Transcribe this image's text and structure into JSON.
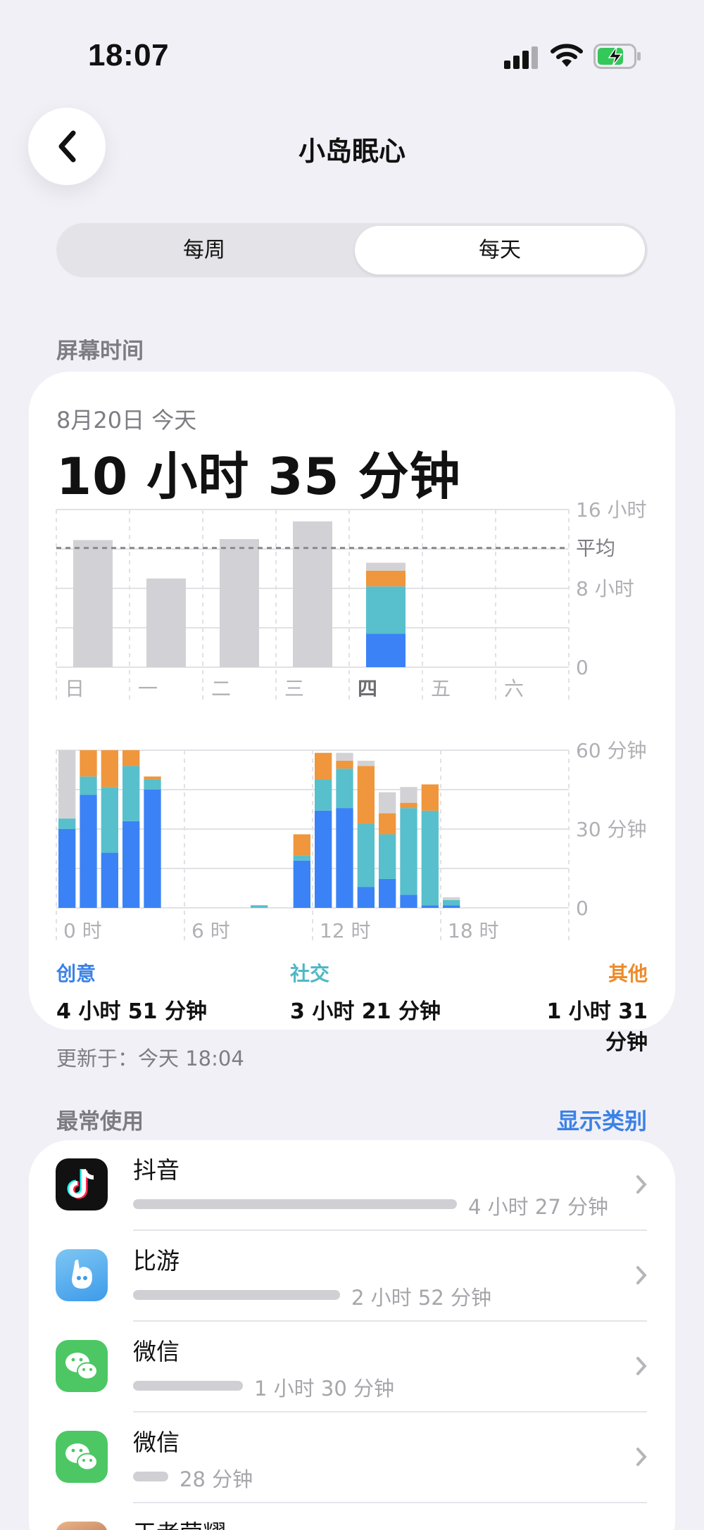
{
  "status_bar": {
    "time": "18:07"
  },
  "nav": {
    "title": "小岛眠心",
    "back_icon": "chevron-left-icon"
  },
  "segment": {
    "weekly_label": "每周",
    "daily_label": "每天",
    "selected": "每天"
  },
  "screen_time": {
    "section_label": "屏幕时间",
    "date": "8月20日 今天",
    "total": "10 小时 35 分钟",
    "updated": "更新于：今天 18:04"
  },
  "colors": {
    "creative": "#3b82f6",
    "social": "#57c0cc",
    "other": "#f0963c",
    "uncategorized": "#d2d2d6",
    "accent": "#3b82e6"
  },
  "chart_data": [
    {
      "type": "bar",
      "categories": [
        "日",
        "一",
        "二",
        "三",
        "四",
        "五",
        "六"
      ],
      "y_tick_labels": [
        "16 小时",
        "8 小时",
        "0"
      ],
      "average_label": "平均",
      "ylim_hours": [
        0,
        16
      ],
      "average_hours": 12.1,
      "series": [
        {
          "name": "creative",
          "values_hours": [
            0,
            0,
            0,
            0,
            3.4
          ]
        },
        {
          "name": "social",
          "values_hours": [
            0,
            0,
            0,
            0,
            4.8
          ]
        },
        {
          "name": "other",
          "values_hours": [
            0,
            0,
            0,
            0,
            1.6
          ]
        },
        {
          "name": "uncategorized",
          "values_hours": [
            12.9,
            9.0,
            13.0,
            14.8,
            0.8
          ]
        }
      ]
    },
    {
      "type": "bar",
      "categories": [
        "0",
        "1",
        "2",
        "3",
        "4",
        "5",
        "6",
        "7",
        "8",
        "9",
        "10",
        "11",
        "12",
        "13",
        "14",
        "15",
        "16",
        "17",
        "18",
        "19",
        "20",
        "21",
        "22",
        "23"
      ],
      "x_tick_labels": [
        "0 时",
        "6 时",
        "12 时",
        "18 时"
      ],
      "y_tick_labels": [
        "60 分钟",
        "30 分钟",
        "0"
      ],
      "ylim_minutes": [
        0,
        60
      ],
      "series": [
        {
          "name": "creative",
          "values": [
            30,
            43,
            21,
            33,
            45,
            0,
            0,
            0,
            0,
            0,
            0,
            18,
            37,
            38,
            8,
            11,
            5,
            1,
            1,
            0,
            0,
            0,
            0,
            0
          ]
        },
        {
          "name": "social",
          "values": [
            4,
            7,
            25,
            21,
            4,
            0,
            0,
            0,
            0,
            1,
            0,
            2,
            12,
            15,
            24,
            17,
            33,
            36,
            2,
            0,
            0,
            0,
            0,
            0
          ]
        },
        {
          "name": "other",
          "values": [
            0,
            10,
            14,
            6,
            1,
            0,
            0,
            0,
            0,
            0,
            0,
            8,
            10,
            3,
            22,
            8,
            2,
            10,
            0,
            0,
            0,
            0,
            0,
            0
          ]
        },
        {
          "name": "uncategorized",
          "values": [
            26,
            0,
            0,
            0,
            0,
            0,
            0,
            0,
            0,
            0,
            0,
            0,
            0,
            3,
            2,
            8,
            6,
            0,
            1,
            0,
            0,
            0,
            0,
            0
          ]
        }
      ]
    }
  ],
  "legend": [
    {
      "category": "创意",
      "value": "4 小时 51 分钟"
    },
    {
      "category": "社交",
      "value": "3 小时 21 分钟"
    },
    {
      "category": "其他",
      "value": "1 小时 31 分钟"
    }
  ],
  "most_used": {
    "section_label": "最常使用",
    "show_categories": "显示类别",
    "apps": [
      {
        "name": "抖音",
        "duration": "4 小时 27 分钟",
        "usage_fraction": 1.0,
        "icon": "douyin-icon"
      },
      {
        "name": "比游",
        "duration": "2 小时 52 分钟",
        "usage_fraction": 0.64,
        "icon": "biyou-icon"
      },
      {
        "name": "微信",
        "duration": "1 小时 30 分钟",
        "usage_fraction": 0.34,
        "icon": "wechat-icon"
      },
      {
        "name": "微信",
        "duration": "28 分钟",
        "usage_fraction": 0.1,
        "icon": "wechat-icon"
      },
      {
        "name": "王者荣耀",
        "duration": "",
        "usage_fraction": 0,
        "icon": "honor-of-kings-icon"
      }
    ]
  }
}
